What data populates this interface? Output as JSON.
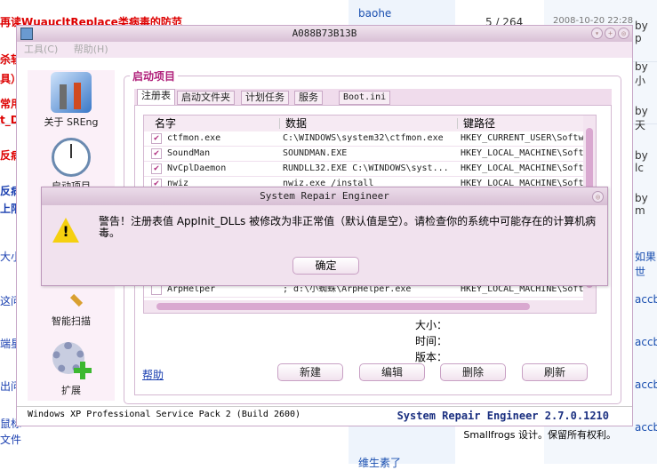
{
  "background": {
    "left_lines": [
      "再读WuaucltReplace类病毒的防范",
      "杀软",
      "具）",
      "常用",
      "t_D",
      "反病",
      "反病",
      "上限",
      "大小",
      "这问",
      "端星",
      "出问",
      "鼠标",
      "文件"
    ],
    "mid": {
      "user": "baohe",
      "count": "5 / 264",
      "date": "2008-10-20 22:28",
      "bottom_text": "维生素了"
    },
    "right": [
      "by p",
      "by 小",
      "by 天",
      "by lc",
      "by m",
      "如果世",
      "accbb",
      "accbb",
      "accbb",
      "accbb"
    ]
  },
  "window": {
    "title": "A088B73B13B",
    "menu": [
      "工具(C)",
      "帮助(H)"
    ],
    "sidebar": [
      {
        "label": "关于 SREng",
        "icon": "tools-icon"
      },
      {
        "label": "启动项目",
        "icon": "clock-icon"
      },
      {
        "label": "智能扫描",
        "icon": "magnifier-icon"
      },
      {
        "label": "扩展",
        "icon": "gear-plus-icon"
      }
    ],
    "group_title": "启动项目",
    "tabs": [
      "注册表",
      "启动文件夹",
      "计划任务",
      "服务",
      "Boot.ini"
    ],
    "columns": [
      "名字",
      "数据",
      "键路径"
    ],
    "rows": [
      {
        "checked": true,
        "name": "ctfmon.exe",
        "data": "C:\\WINDOWS\\system32\\ctfmon.exe",
        "key": "HKEY_CURRENT_USER\\Softw"
      },
      {
        "checked": true,
        "name": "SoundMan",
        "data": "SOUNDMAN.EXE",
        "key": "HKEY_LOCAL_MACHINE\\Soft"
      },
      {
        "checked": true,
        "name": "NvCplDaemon",
        "data": "RUNDLL32.EXE C:\\WINDOWS\\syst...",
        "key": "HKEY_LOCAL_MACHINE\\Soft"
      },
      {
        "checked": true,
        "name": "nwiz",
        "data": "nwiz.exe /install",
        "key": "HKEY_LOCAL_MACHINE\\Soft"
      },
      {
        "checked": false,
        "name": "ArpHelper",
        "data": "; d:\\小蜘蛛\\ArpHelper.exe",
        "key": "HKEY_LOCAL_MACHINE\\Soft"
      }
    ],
    "info": {
      "size": "大小：",
      "time": "时间：",
      "version": "版本："
    },
    "help_link": "帮助",
    "buttons": [
      "新建",
      "编辑",
      "删除",
      "刷新"
    ],
    "os": "Windows XP Professional Service Pack 2 (Build 2600)",
    "product": "System Repair Engineer 2.7.0.1210",
    "copyright": "Smallfrogs 设计。保留所有权利。"
  },
  "dialog": {
    "title": "System Repair Engineer",
    "message": "警告！注册表值 AppInit_DLLs 被修改为非正常值（默认值是空）。请检查你的系统中可能存在的计算机病毒。",
    "ok": "确定"
  }
}
